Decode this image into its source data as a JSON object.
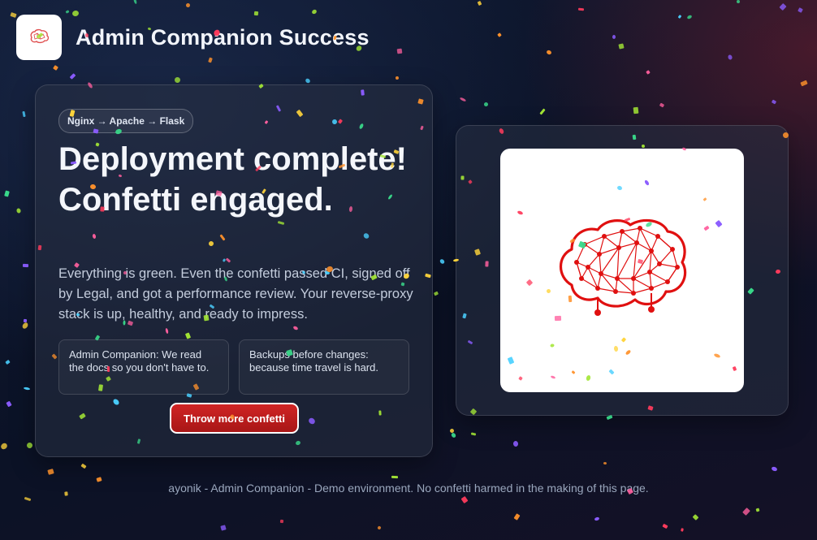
{
  "app": {
    "title": "Admin Companion Success",
    "logo_icon": "brain-icon"
  },
  "hero": {
    "stack_pill": "Nginx → Apache → Flask",
    "headline": "Deployment complete! Confetti engaged.",
    "lede": "Everything is green. Even the confetti passed CI, signed off by Legal, and got a performance review. Your reverse-proxy stack is up, healthy, and ready to impress.",
    "tiles": [
      "Admin Companion: We read the docs so you don't have to.",
      "Backups before changes: because time travel is hard."
    ],
    "cta_label": "Throw more confetti"
  },
  "illustration": {
    "icon": "brain-network-icon",
    "color": "#e01010"
  },
  "footer": {
    "text": "ayonik - Admin Companion - Demo environment. No confetti harmed in the making of this page."
  },
  "colors": {
    "background": "#0b1226",
    "accent_red": "#c41e1e",
    "confetti": [
      "#ff5f9e",
      "#ffd43b",
      "#4ad0ff",
      "#8b5cff",
      "#39d98a",
      "#ff922b",
      "#ff3b5c",
      "#a3e635"
    ]
  }
}
